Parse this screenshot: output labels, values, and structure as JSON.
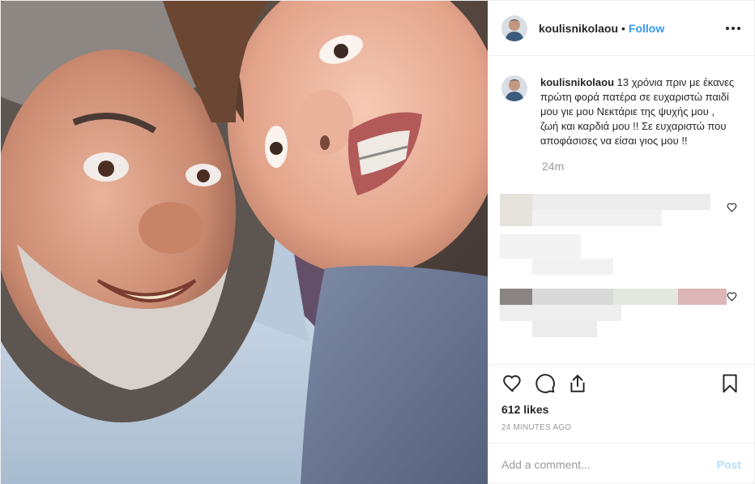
{
  "header": {
    "username": "koulisnikolaou",
    "separator": "•",
    "follow_label": "Follow",
    "more_icon": "more-horizontal-icon"
  },
  "caption": {
    "username": "koulisnikolaou",
    "text": "13 χρόνια πριν με έκανες πρώτη φορά πατέρα σε ευχαριστώ παιδί μου γιε μου Νεκτάριε της ψυχής μου , ζωή και καρδιά μου !! Σε ευχαριστώ που αποφάσισες να είσαι γιος μου !!",
    "time_ago": "24m"
  },
  "actions": {
    "like_icon": "heart-icon",
    "comment_icon": "comment-icon",
    "share_icon": "share-icon",
    "save_icon": "bookmark-icon"
  },
  "likes": "612 likes",
  "timestamp": "24 MINUTES AGO",
  "add_comment": {
    "placeholder": "Add a comment...",
    "post_label": "Post"
  },
  "colors": {
    "accent": "#3897f0",
    "post_disabled": "#b2dffc",
    "muted": "#999999",
    "border": "#efefef"
  }
}
